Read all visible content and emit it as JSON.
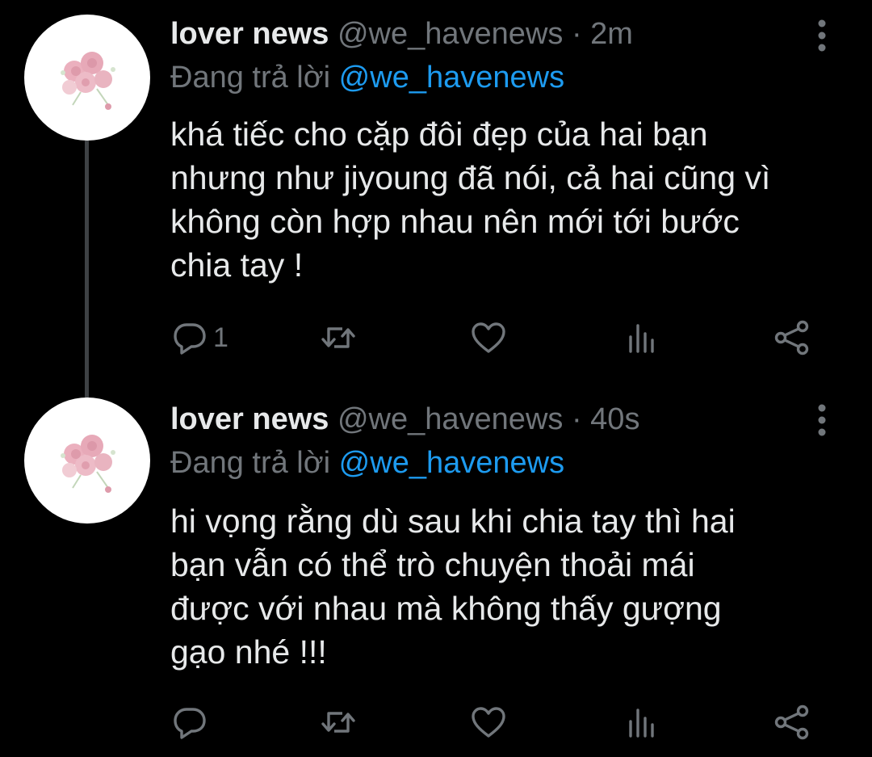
{
  "colors": {
    "background": "#000000",
    "text": "#e7e9ea",
    "muted": "#71767b",
    "link": "#1d9bf0",
    "thread_line": "#3e4144"
  },
  "tweets": [
    {
      "display_name": "lover news",
      "handle": "@we_havenews",
      "separator": "·",
      "time": "2m",
      "reply_prefix": "Đang trả lời",
      "reply_to": "@we_havenews",
      "text_lines": [
        "khá tiếc cho cặp đôi đẹp của hai bạn",
        "nhưng như jiyoung đã nói, cả hai cũng vì",
        "không còn hợp nhau nên mới tới bước",
        "chia tay !"
      ],
      "reply_count": "1",
      "icons": [
        "reply-icon",
        "retweet-icon",
        "heart-icon",
        "views-icon",
        "share-icon",
        "more-icon"
      ]
    },
    {
      "display_name": "lover news",
      "handle": "@we_havenews",
      "separator": "·",
      "time": "40s",
      "reply_prefix": "Đang trả lời",
      "reply_to": "@we_havenews",
      "text_lines": [
        "hi vọng rằng dù sau khi chia tay thì hai",
        "bạn vẫn có thể trò chuyện thoải mái",
        "được với nhau mà không thấy gượng",
        "gạo nhé !!!"
      ],
      "reply_count": "",
      "icons": [
        "reply-icon",
        "retweet-icon",
        "heart-icon",
        "views-icon",
        "share-icon",
        "more-icon"
      ]
    }
  ]
}
